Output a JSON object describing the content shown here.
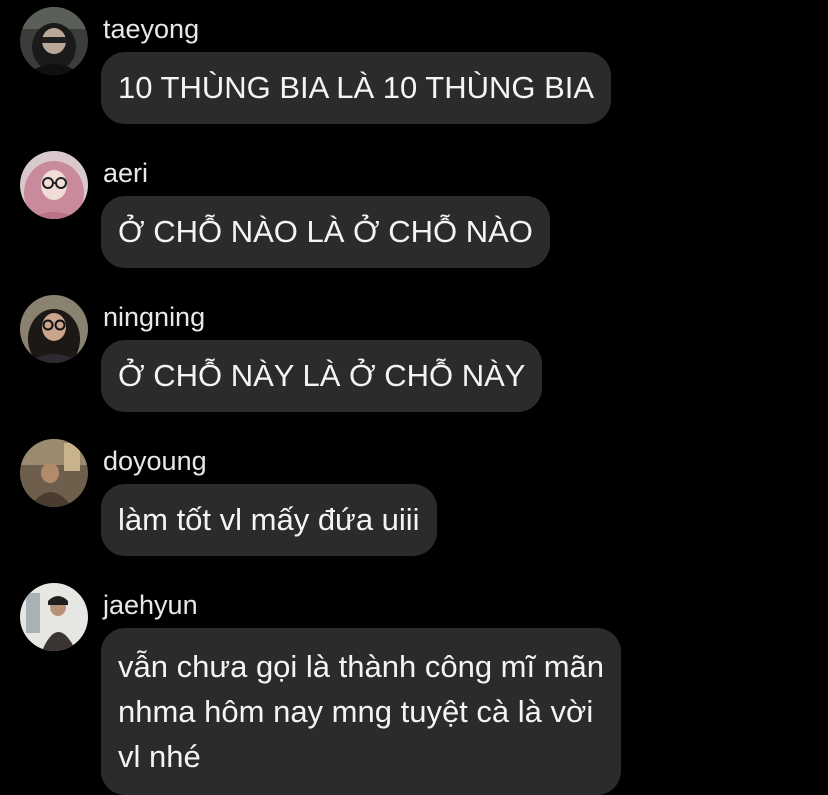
{
  "messages": [
    {
      "sender": "taeyong",
      "lines": [
        "10 THÙNG BIA LÀ 10 THÙNG BIA"
      ]
    },
    {
      "sender": "aeri",
      "lines": [
        "Ở CHỖ NÀO LÀ Ở CHỖ NÀO"
      ]
    },
    {
      "sender": "ningning",
      "lines": [
        "Ở CHỖ NÀY LÀ Ở CHỖ NÀY"
      ]
    },
    {
      "sender": "doyoung",
      "lines": [
        "làm tốt vl mấy đứa uiii"
      ]
    },
    {
      "sender": "jaehyun",
      "lines": [
        "vẫn chưa gọi là thành công mĩ mãn",
        "nhma hôm nay mng tuyệt cà là vời",
        "vl nhé"
      ]
    }
  ],
  "colors": {
    "background": "#000000",
    "bubble": "#2b2b2e",
    "sender_name": "#e8e8e8",
    "message_text": "#f4f4f4"
  }
}
